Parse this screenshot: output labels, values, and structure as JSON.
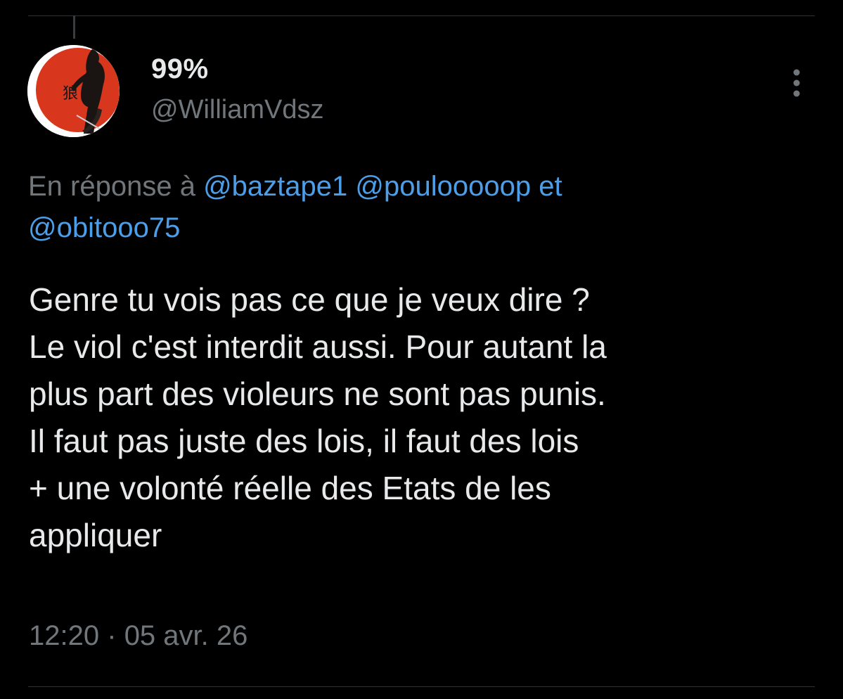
{
  "tweet": {
    "author": {
      "display_name": "99%",
      "handle": "@WilliamVdsz",
      "avatar_icon": "avatar-figure-red-sun",
      "avatar_glyph": "狼"
    },
    "more_icon": "more-vertical-icon",
    "reply_to": {
      "prefix": "En réponse à",
      "mentions": [
        "@baztape1",
        "@poulooooop",
        "@obitooo75"
      ],
      "conjunction": "et"
    },
    "text_lines": [
      "Genre tu vois pas ce que je veux dire ?",
      "Le viol c'est interdit aussi. Pour autant la",
      "plus part des violeurs ne sont pas punis.",
      "Il faut pas juste des lois, il faut des lois",
      "+ une volonté réelle des Etats de les",
      "appliquer"
    ],
    "time": "12:20",
    "separator": "·",
    "date": "05 avr. 26"
  },
  "colors": {
    "background": "#000000",
    "text": "#e7e9ea",
    "secondary": "#71767b",
    "link": "#4d9ee9",
    "divider": "#2f3336",
    "avatar_sun": "#d8371e"
  }
}
